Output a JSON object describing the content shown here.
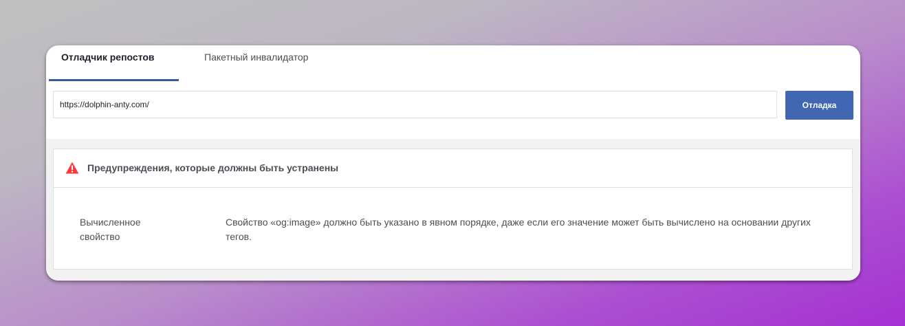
{
  "tabs": [
    {
      "label": "Отладчик репостов",
      "active": true
    },
    {
      "label": "Пакетный инвалидатор",
      "active": false
    }
  ],
  "url_input": {
    "value": "https://dolphin-anty.com/"
  },
  "debug_button": {
    "label": "Отладка"
  },
  "warnings": {
    "title": "Предупреждения, которые должны быть устранены",
    "icon": "warning-triangle-icon",
    "icon_color": "#fa3e3e",
    "rows": [
      {
        "label": "Вычисленное свойство",
        "text": "Свойство «og:image» должно быть указано в явном порядке, даже если его значение может быть вычислено на основании других тегов."
      }
    ]
  },
  "colors": {
    "accent": "#4267b2",
    "tab_underline": "#3b5998"
  }
}
